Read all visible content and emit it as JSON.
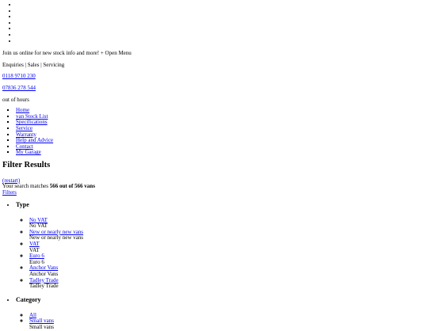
{
  "top_bullets_count": 7,
  "header": {
    "intro": "Join us online for new stock info and more! + Open Menu",
    "services": "Enquiries | Sales | Servicing",
    "phone_1": "0118 9710 230",
    "phone_2": "07836 278 544",
    "out_of_hours": "out of hours"
  },
  "nav": {
    "items": [
      "Home",
      "van Stock List",
      "Specifications",
      "Service",
      "Warranty",
      "Help and Advice",
      "Contact",
      "My Garage"
    ]
  },
  "filter": {
    "title": "Filter Results",
    "restart_link": "(restart)",
    "matches_prefix": "Your search matches ",
    "matches_count": "566 out of 566 vans",
    "filters_link": "Filters",
    "groups": [
      {
        "title": "Type",
        "options": [
          {
            "link": "No VAT",
            "label": "No VAT"
          },
          {
            "link": "New or nearly new vans",
            "label": "New or nearly new vans"
          },
          {
            "link": "VAT",
            "label": "VAT"
          },
          {
            "link": "Euro 6",
            "label": "Euro 6"
          },
          {
            "link": "Anchor Vans",
            "label": "Anchor Vans"
          },
          {
            "link": "Tadley Trade",
            "label": "Tadley Trade"
          }
        ]
      },
      {
        "title": "Category",
        "options": [
          {
            "link": "All",
            "label": null
          },
          {
            "link": "Small vans",
            "label": "Small vans"
          }
        ]
      }
    ]
  }
}
